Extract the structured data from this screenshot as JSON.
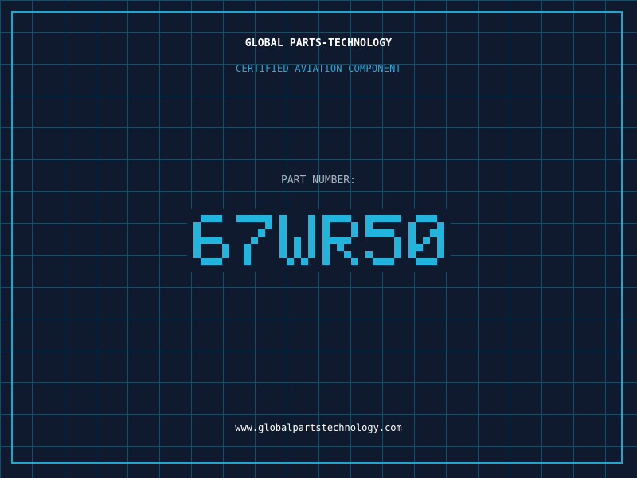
{
  "header": {
    "brand": "GLOBAL PARTS-TECHNOLOGY",
    "tagline": "CERTIFIED AVIATION COMPONENT"
  },
  "part": {
    "label": "PART NUMBER:",
    "number": "67WR50"
  },
  "footer": {
    "url": "www.globalpartstechnology.com"
  },
  "colors": {
    "background": "#0f1a2e",
    "grid": "#1d4a63",
    "frame": "#1fa6cc",
    "accent": "#21b4dc",
    "tagline": "#29a9d6",
    "label": "#a9b4c2",
    "text": "#ffffff"
  }
}
